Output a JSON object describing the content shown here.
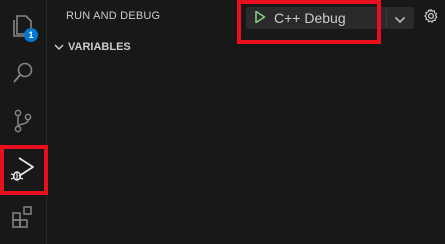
{
  "activity_bar": {
    "items": [
      {
        "name": "explorer",
        "icon": "files-icon",
        "badge": "1"
      },
      {
        "name": "search",
        "icon": "search-icon"
      },
      {
        "name": "source-control",
        "icon": "source-control-icon"
      },
      {
        "name": "run-and-debug",
        "icon": "run-debug-icon",
        "active": true
      },
      {
        "name": "extensions",
        "icon": "extensions-icon"
      }
    ]
  },
  "sidebar": {
    "title": "RUN AND DEBUG",
    "launch_config": {
      "name": "C++ Debug",
      "play_icon": "play-icon",
      "dropdown_icon": "chevron-down-icon"
    },
    "settings_icon": "gear-icon",
    "sections": [
      {
        "title": "VARIABLES",
        "expanded": true
      }
    ]
  },
  "colors": {
    "background": "#181818",
    "text": "#cccccc",
    "play_green": "#89d185",
    "badge_blue": "#0078d4",
    "highlight_red": "#e8101f"
  }
}
